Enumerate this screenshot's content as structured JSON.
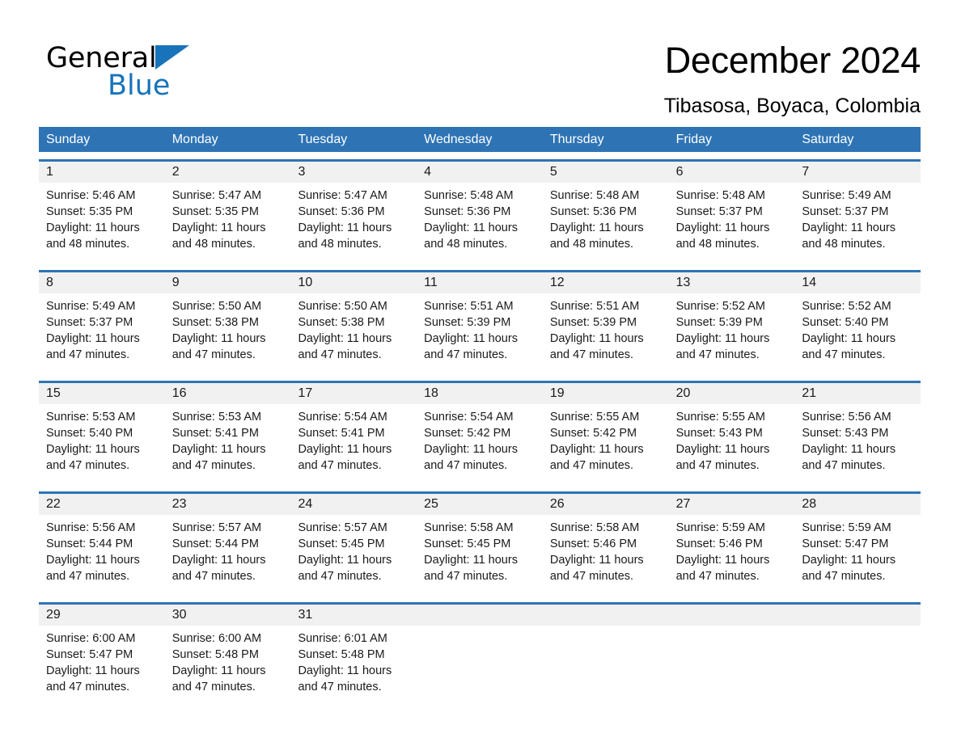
{
  "brand": {
    "name_part1": "General",
    "name_part2": "Blue",
    "logo_icon": "triangle-icon"
  },
  "header": {
    "month_title": "December 2024",
    "location": "Tibasosa, Boyaca, Colombia"
  },
  "colors": {
    "header_blue": "#2e74b5",
    "brand_blue": "#1873ba",
    "date_band_gray": "#f1f1f1",
    "text": "#1a1a1a"
  },
  "weekdays": [
    "Sunday",
    "Monday",
    "Tuesday",
    "Wednesday",
    "Thursday",
    "Friday",
    "Saturday"
  ],
  "weeks": [
    {
      "days": [
        {
          "num": "1",
          "sunrise": "Sunrise: 5:46 AM",
          "sunset": "Sunset: 5:35 PM",
          "daylight1": "Daylight: 11 hours",
          "daylight2": "and 48 minutes."
        },
        {
          "num": "2",
          "sunrise": "Sunrise: 5:47 AM",
          "sunset": "Sunset: 5:35 PM",
          "daylight1": "Daylight: 11 hours",
          "daylight2": "and 48 minutes."
        },
        {
          "num": "3",
          "sunrise": "Sunrise: 5:47 AM",
          "sunset": "Sunset: 5:36 PM",
          "daylight1": "Daylight: 11 hours",
          "daylight2": "and 48 minutes."
        },
        {
          "num": "4",
          "sunrise": "Sunrise: 5:48 AM",
          "sunset": "Sunset: 5:36 PM",
          "daylight1": "Daylight: 11 hours",
          "daylight2": "and 48 minutes."
        },
        {
          "num": "5",
          "sunrise": "Sunrise: 5:48 AM",
          "sunset": "Sunset: 5:36 PM",
          "daylight1": "Daylight: 11 hours",
          "daylight2": "and 48 minutes."
        },
        {
          "num": "6",
          "sunrise": "Sunrise: 5:48 AM",
          "sunset": "Sunset: 5:37 PM",
          "daylight1": "Daylight: 11 hours",
          "daylight2": "and 48 minutes."
        },
        {
          "num": "7",
          "sunrise": "Sunrise: 5:49 AM",
          "sunset": "Sunset: 5:37 PM",
          "daylight1": "Daylight: 11 hours",
          "daylight2": "and 48 minutes."
        }
      ]
    },
    {
      "days": [
        {
          "num": "8",
          "sunrise": "Sunrise: 5:49 AM",
          "sunset": "Sunset: 5:37 PM",
          "daylight1": "Daylight: 11 hours",
          "daylight2": "and 47 minutes."
        },
        {
          "num": "9",
          "sunrise": "Sunrise: 5:50 AM",
          "sunset": "Sunset: 5:38 PM",
          "daylight1": "Daylight: 11 hours",
          "daylight2": "and 47 minutes."
        },
        {
          "num": "10",
          "sunrise": "Sunrise: 5:50 AM",
          "sunset": "Sunset: 5:38 PM",
          "daylight1": "Daylight: 11 hours",
          "daylight2": "and 47 minutes."
        },
        {
          "num": "11",
          "sunrise": "Sunrise: 5:51 AM",
          "sunset": "Sunset: 5:39 PM",
          "daylight1": "Daylight: 11 hours",
          "daylight2": "and 47 minutes."
        },
        {
          "num": "12",
          "sunrise": "Sunrise: 5:51 AM",
          "sunset": "Sunset: 5:39 PM",
          "daylight1": "Daylight: 11 hours",
          "daylight2": "and 47 minutes."
        },
        {
          "num": "13",
          "sunrise": "Sunrise: 5:52 AM",
          "sunset": "Sunset: 5:39 PM",
          "daylight1": "Daylight: 11 hours",
          "daylight2": "and 47 minutes."
        },
        {
          "num": "14",
          "sunrise": "Sunrise: 5:52 AM",
          "sunset": "Sunset: 5:40 PM",
          "daylight1": "Daylight: 11 hours",
          "daylight2": "and 47 minutes."
        }
      ]
    },
    {
      "days": [
        {
          "num": "15",
          "sunrise": "Sunrise: 5:53 AM",
          "sunset": "Sunset: 5:40 PM",
          "daylight1": "Daylight: 11 hours",
          "daylight2": "and 47 minutes."
        },
        {
          "num": "16",
          "sunrise": "Sunrise: 5:53 AM",
          "sunset": "Sunset: 5:41 PM",
          "daylight1": "Daylight: 11 hours",
          "daylight2": "and 47 minutes."
        },
        {
          "num": "17",
          "sunrise": "Sunrise: 5:54 AM",
          "sunset": "Sunset: 5:41 PM",
          "daylight1": "Daylight: 11 hours",
          "daylight2": "and 47 minutes."
        },
        {
          "num": "18",
          "sunrise": "Sunrise: 5:54 AM",
          "sunset": "Sunset: 5:42 PM",
          "daylight1": "Daylight: 11 hours",
          "daylight2": "and 47 minutes."
        },
        {
          "num": "19",
          "sunrise": "Sunrise: 5:55 AM",
          "sunset": "Sunset: 5:42 PM",
          "daylight1": "Daylight: 11 hours",
          "daylight2": "and 47 minutes."
        },
        {
          "num": "20",
          "sunrise": "Sunrise: 5:55 AM",
          "sunset": "Sunset: 5:43 PM",
          "daylight1": "Daylight: 11 hours",
          "daylight2": "and 47 minutes."
        },
        {
          "num": "21",
          "sunrise": "Sunrise: 5:56 AM",
          "sunset": "Sunset: 5:43 PM",
          "daylight1": "Daylight: 11 hours",
          "daylight2": "and 47 minutes."
        }
      ]
    },
    {
      "days": [
        {
          "num": "22",
          "sunrise": "Sunrise: 5:56 AM",
          "sunset": "Sunset: 5:44 PM",
          "daylight1": "Daylight: 11 hours",
          "daylight2": "and 47 minutes."
        },
        {
          "num": "23",
          "sunrise": "Sunrise: 5:57 AM",
          "sunset": "Sunset: 5:44 PM",
          "daylight1": "Daylight: 11 hours",
          "daylight2": "and 47 minutes."
        },
        {
          "num": "24",
          "sunrise": "Sunrise: 5:57 AM",
          "sunset": "Sunset: 5:45 PM",
          "daylight1": "Daylight: 11 hours",
          "daylight2": "and 47 minutes."
        },
        {
          "num": "25",
          "sunrise": "Sunrise: 5:58 AM",
          "sunset": "Sunset: 5:45 PM",
          "daylight1": "Daylight: 11 hours",
          "daylight2": "and 47 minutes."
        },
        {
          "num": "26",
          "sunrise": "Sunrise: 5:58 AM",
          "sunset": "Sunset: 5:46 PM",
          "daylight1": "Daylight: 11 hours",
          "daylight2": "and 47 minutes."
        },
        {
          "num": "27",
          "sunrise": "Sunrise: 5:59 AM",
          "sunset": "Sunset: 5:46 PM",
          "daylight1": "Daylight: 11 hours",
          "daylight2": "and 47 minutes."
        },
        {
          "num": "28",
          "sunrise": "Sunrise: 5:59 AM",
          "sunset": "Sunset: 5:47 PM",
          "daylight1": "Daylight: 11 hours",
          "daylight2": "and 47 minutes."
        }
      ]
    },
    {
      "days": [
        {
          "num": "29",
          "sunrise": "Sunrise: 6:00 AM",
          "sunset": "Sunset: 5:47 PM",
          "daylight1": "Daylight: 11 hours",
          "daylight2": "and 47 minutes."
        },
        {
          "num": "30",
          "sunrise": "Sunrise: 6:00 AM",
          "sunset": "Sunset: 5:48 PM",
          "daylight1": "Daylight: 11 hours",
          "daylight2": "and 47 minutes."
        },
        {
          "num": "31",
          "sunrise": "Sunrise: 6:01 AM",
          "sunset": "Sunset: 5:48 PM",
          "daylight1": "Daylight: 11 hours",
          "daylight2": "and 47 minutes."
        },
        {
          "num": "",
          "sunrise": "",
          "sunset": "",
          "daylight1": "",
          "daylight2": ""
        },
        {
          "num": "",
          "sunrise": "",
          "sunset": "",
          "daylight1": "",
          "daylight2": ""
        },
        {
          "num": "",
          "sunrise": "",
          "sunset": "",
          "daylight1": "",
          "daylight2": ""
        },
        {
          "num": "",
          "sunrise": "",
          "sunset": "",
          "daylight1": "",
          "daylight2": ""
        }
      ]
    }
  ]
}
